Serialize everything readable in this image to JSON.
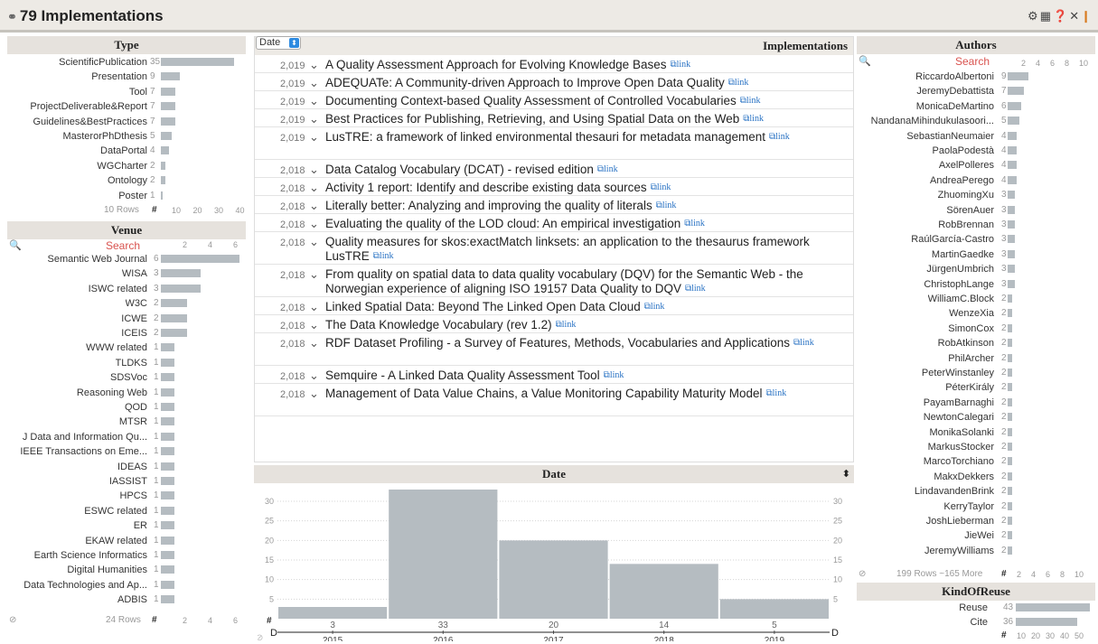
{
  "app": {
    "title": "79 Implementations",
    "tool_icons": [
      "gear-icon",
      "table-icon",
      "help-icon",
      "expand-icon",
      "brand-logo-icon"
    ]
  },
  "type_facet": {
    "header": "Type",
    "items": [
      {
        "label": "ScientificPublication",
        "count": "35",
        "value": 35
      },
      {
        "label": "Presentation",
        "count": "9",
        "value": 9
      },
      {
        "label": "Tool",
        "count": "7",
        "value": 7
      },
      {
        "label": "ProjectDeliverable&Report",
        "count": "7",
        "value": 7
      },
      {
        "label": "Guidelines&BestPractices",
        "count": "7",
        "value": 7
      },
      {
        "label": "MasterorPhDthesis",
        "count": "5",
        "value": 5
      },
      {
        "label": "DataPortal",
        "count": "4",
        "value": 4
      },
      {
        "label": "WGCharter",
        "count": "2",
        "value": 2
      },
      {
        "label": "Ontology",
        "count": "2",
        "value": 2
      },
      {
        "label": "Poster",
        "count": "1",
        "value": 1
      }
    ],
    "footer": "10 Rows",
    "hash": "#",
    "ticks": [
      "10",
      "20",
      "30",
      "40"
    ]
  },
  "venue_facet": {
    "header": "Venue",
    "search": "Search",
    "ticks": [
      "2",
      "4",
      "6"
    ],
    "items": [
      {
        "label": "Semantic Web Journal",
        "count": "6",
        "value": 6
      },
      {
        "label": "WISA",
        "count": "3",
        "value": 3
      },
      {
        "label": "ISWC related",
        "count": "3",
        "value": 3
      },
      {
        "label": "W3C",
        "count": "2",
        "value": 2
      },
      {
        "label": "ICWE",
        "count": "2",
        "value": 2
      },
      {
        "label": "ICEIS",
        "count": "2",
        "value": 2
      },
      {
        "label": "WWW related",
        "count": "1",
        "value": 1
      },
      {
        "label": "TLDKS",
        "count": "1",
        "value": 1
      },
      {
        "label": "SDSVoc",
        "count": "1",
        "value": 1
      },
      {
        "label": "Reasoning Web",
        "count": "1",
        "value": 1
      },
      {
        "label": "QOD",
        "count": "1",
        "value": 1
      },
      {
        "label": "MTSR",
        "count": "1",
        "value": 1
      },
      {
        "label": "J Data and Information Qu...",
        "count": "1",
        "value": 1
      },
      {
        "label": "IEEE Transactions on Eme...",
        "count": "1",
        "value": 1
      },
      {
        "label": "IDEAS",
        "count": "1",
        "value": 1
      },
      {
        "label": "IASSIST",
        "count": "1",
        "value": 1
      },
      {
        "label": "HPCS",
        "count": "1",
        "value": 1
      },
      {
        "label": "ESWC related",
        "count": "1",
        "value": 1
      },
      {
        "label": "ER",
        "count": "1",
        "value": 1
      },
      {
        "label": "EKAW related",
        "count": "1",
        "value": 1
      },
      {
        "label": "Earth Science Informatics",
        "count": "1",
        "value": 1
      },
      {
        "label": "Digital Humanities",
        "count": "1",
        "value": 1
      },
      {
        "label": "Data Technologies and Ap...",
        "count": "1",
        "value": 1
      },
      {
        "label": "ADBIS",
        "count": "1",
        "value": 1
      }
    ],
    "footer": "24 Rows",
    "hash": "#",
    "foot_ticks": [
      "2",
      "4",
      "6"
    ]
  },
  "implementations": {
    "sort_select": "Date",
    "header": "Implementations",
    "link_label": "link",
    "rows": [
      {
        "year": "2,019",
        "title": "A Quality Assessment Approach for Evolving Knowledge Bases"
      },
      {
        "year": "2,019",
        "title": "ADEQUATe: A Community-driven Approach to Improve Open Data Quality"
      },
      {
        "year": "2,019",
        "title": "Documenting Context-based Quality Assessment of Controlled Vocabularies"
      },
      {
        "year": "2,019",
        "title": "Best Practices for Publishing, Retrieving, and Using Spatial Data on the Web"
      },
      {
        "year": "2,019",
        "title": "LusTRE: a framework of linked environmental thesauri for metadata management"
      },
      {
        "year": "2,018",
        "title": "Data Catalog Vocabulary (DCAT) - revised edition"
      },
      {
        "year": "2,018",
        "title": "Activity 1 report: Identify and describe existing data sources"
      },
      {
        "year": "2,018",
        "title": "Literally better: Analyzing and improving the quality of literals"
      },
      {
        "year": "2,018",
        "title": "Evaluating the quality of the LOD cloud: An empirical investigation"
      },
      {
        "year": "2,018",
        "title": "Quality measures for skos:exactMatch linksets: an application to the thesaurus framework LusTRE"
      },
      {
        "year": "2,018",
        "title": "From quality on spatial data to data quality vocabulary (DQV) for the Semantic Web - the Norwegian experience of aligning ISO 19157 Data Quality to DQV"
      },
      {
        "year": "2,018",
        "title": "Linked Spatial Data: Beyond The Linked Open Data Cloud"
      },
      {
        "year": "2,018",
        "title": "The Data Knowledge Vocabulary (rev 1.2)"
      },
      {
        "year": "2,018",
        "title": "RDF Dataset Profiling - a Survey of Features, Methods, Vocabularies and Applications"
      },
      {
        "year": "2,018",
        "title": "Semquire - A Linked Data Quality Assessment Tool"
      },
      {
        "year": "2,018",
        "title": "Management of Data Value Chains, a Value Monitoring Capability Maturity Model"
      }
    ]
  },
  "date_chart": {
    "header": "Date",
    "hash": "#",
    "left_label": "D",
    "right_label": "D",
    "chart_data": {
      "type": "bar",
      "categories": [
        "2015",
        "2016",
        "2017",
        "2018",
        "2019"
      ],
      "values": [
        3,
        33,
        20,
        14,
        5
      ],
      "value_labels": [
        "3",
        "33",
        "20",
        "14",
        "5"
      ],
      "yticks": [
        "5",
        "10",
        "15",
        "20",
        "25",
        "30"
      ],
      "ylim": [
        0,
        33
      ]
    },
    "colors": {
      "bar": "#b5bcc1"
    }
  },
  "authors_facet": {
    "header": "Authors",
    "search": "Search",
    "ticks": [
      "2",
      "4",
      "6",
      "8",
      "10"
    ],
    "items": [
      {
        "label": "RiccardoAlbertoni",
        "count": "9",
        "value": 9
      },
      {
        "label": "JeremyDebattista",
        "count": "7",
        "value": 7
      },
      {
        "label": "MonicaDeMartino",
        "count": "6",
        "value": 6
      },
      {
        "label": "NandanaMihindukulasoori...",
        "count": "5",
        "value": 5
      },
      {
        "label": "SebastianNeumaier",
        "count": "4",
        "value": 4
      },
      {
        "label": "PaolaPodestà",
        "count": "4",
        "value": 4
      },
      {
        "label": "AxelPolleres",
        "count": "4",
        "value": 4
      },
      {
        "label": "AndreaPerego",
        "count": "4",
        "value": 4
      },
      {
        "label": "ZhuomingXu",
        "count": "3",
        "value": 3
      },
      {
        "label": "SörenAuer",
        "count": "3",
        "value": 3
      },
      {
        "label": "RobBrennan",
        "count": "3",
        "value": 3
      },
      {
        "label": "RaúlGarcía-Castro",
        "count": "3",
        "value": 3
      },
      {
        "label": "MartinGaedke",
        "count": "3",
        "value": 3
      },
      {
        "label": "JürgenUmbrich",
        "count": "3",
        "value": 3
      },
      {
        "label": "ChristophLange",
        "count": "3",
        "value": 3
      },
      {
        "label": "WilliamC.Block",
        "count": "2",
        "value": 2
      },
      {
        "label": "WenzeXia",
        "count": "2",
        "value": 2
      },
      {
        "label": "SimonCox",
        "count": "2",
        "value": 2
      },
      {
        "label": "RobAtkinson",
        "count": "2",
        "value": 2
      },
      {
        "label": "PhilArcher",
        "count": "2",
        "value": 2
      },
      {
        "label": "PeterWinstanley",
        "count": "2",
        "value": 2
      },
      {
        "label": "PéterKirály",
        "count": "2",
        "value": 2
      },
      {
        "label": "PayamBarnaghi",
        "count": "2",
        "value": 2
      },
      {
        "label": "NewtonCalegari",
        "count": "2",
        "value": 2
      },
      {
        "label": "MonikaSolanki",
        "count": "2",
        "value": 2
      },
      {
        "label": "MarkusStocker",
        "count": "2",
        "value": 2
      },
      {
        "label": "MarcoTorchiano",
        "count": "2",
        "value": 2
      },
      {
        "label": "MakxDekkers",
        "count": "2",
        "value": 2
      },
      {
        "label": "LindavandenBrink",
        "count": "2",
        "value": 2
      },
      {
        "label": "KerryTaylor",
        "count": "2",
        "value": 2
      },
      {
        "label": "JoshLieberman",
        "count": "2",
        "value": 2
      },
      {
        "label": "JieWei",
        "count": "2",
        "value": 2
      },
      {
        "label": "JeremyWilliams",
        "count": "2",
        "value": 2
      }
    ],
    "footer": "199 Rows ~165 More",
    "hash": "#",
    "foot_ticks": [
      "2",
      "4",
      "6",
      "8",
      "10"
    ]
  },
  "reuse_facet": {
    "header": "KindOfReuse",
    "items": [
      {
        "label": "Reuse",
        "count": "43",
        "value": 43
      },
      {
        "label": "Cite",
        "count": "36",
        "value": 36
      }
    ],
    "hash": "#",
    "ticks": [
      "10",
      "20",
      "30",
      "40",
      "50"
    ]
  }
}
